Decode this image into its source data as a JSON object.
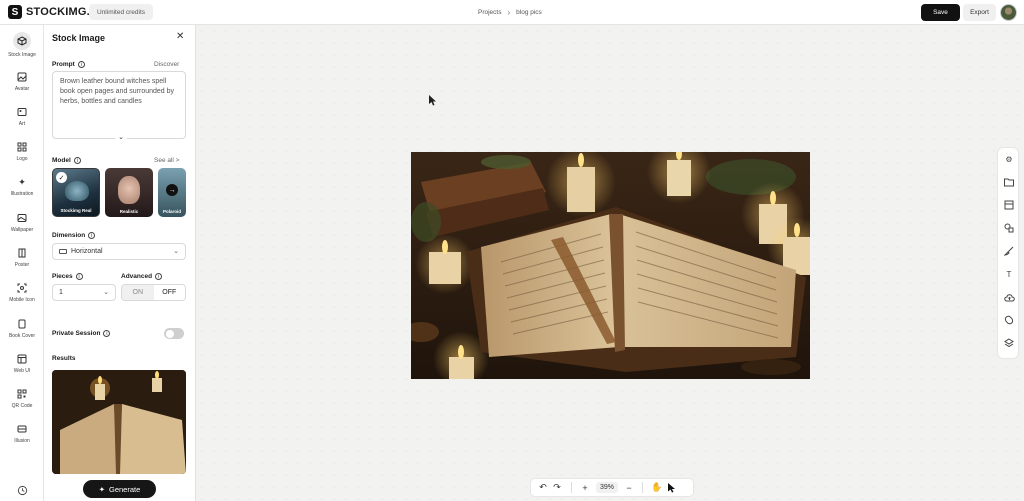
{
  "topbar": {
    "logo_text": "STOCKIMG.AI",
    "credits_label": "Unlimited credits",
    "breadcrumb": [
      "Projects",
      "blog pics"
    ],
    "save_label": "Save",
    "export_label": "Export"
  },
  "leftnav": {
    "items": [
      {
        "label": "Stock Image",
        "icon": "cube-icon",
        "active": true
      },
      {
        "label": "Avatar",
        "icon": "image-icon"
      },
      {
        "label": "Art",
        "icon": "art-icon"
      },
      {
        "label": "Logo",
        "icon": "grid-icon"
      },
      {
        "label": "Illustration",
        "icon": "sparkle-icon"
      },
      {
        "label": "Wallpaper",
        "icon": "wallpaper-icon"
      },
      {
        "label": "Poster",
        "icon": "poster-icon"
      },
      {
        "label": "Mobile Icon",
        "icon": "mobile-icon"
      },
      {
        "label": "Book Cover",
        "icon": "book-icon"
      },
      {
        "label": "Web UI",
        "icon": "web-icon"
      },
      {
        "label": "QR Code",
        "icon": "qr-icon"
      },
      {
        "label": "Illusion",
        "icon": "illusion-icon"
      }
    ]
  },
  "panel": {
    "title": "Stock Image",
    "prompt_label": "Prompt",
    "discover_label": "Discover",
    "prompt_text": "Brown leather bound witches spell book open pages and surrounded by herbs, bottles and candles",
    "model_label": "Model",
    "see_all_label": "See all >",
    "models": [
      {
        "name": "Stockimg Real",
        "selected": true
      },
      {
        "name": "Realistic"
      },
      {
        "name": "Polaroid"
      }
    ],
    "dimension_label": "Dimension",
    "dimension_value": "Horizontal",
    "pieces_label": "Pieces",
    "pieces_value": "1",
    "advanced_label": "Advanced",
    "advanced_on": "ON",
    "advanced_off": "OFF",
    "private_label": "Private Session",
    "results_label": "Results",
    "generate_label": "Generate"
  },
  "bottom_toolbar": {
    "zoom": "39%"
  },
  "colors": {
    "primary_button": "#111111",
    "canvas_bg": "#f2f2f1"
  }
}
